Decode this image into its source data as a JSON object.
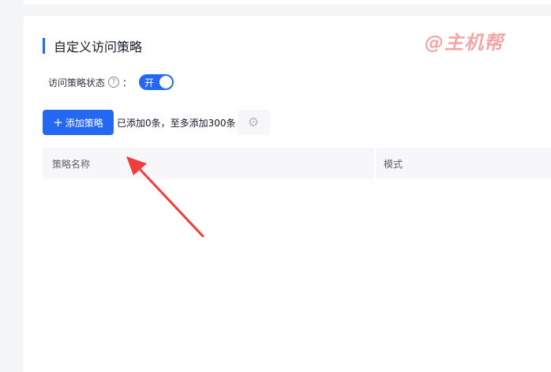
{
  "section": {
    "title": "自定义访问策略"
  },
  "watermark": {
    "text": "@主机帮"
  },
  "status": {
    "label": "访问策略状态",
    "help_icon": "help-circle-icon",
    "help_glyph": "?",
    "colon": "：",
    "toggle_text": "开",
    "toggle_on": true
  },
  "toolbar": {
    "add_label": "添加策略",
    "plus_glyph": "+",
    "count_text": "已添加0条，至多添加300条",
    "gear_icon": "gear-icon",
    "gear_glyph": "⚙"
  },
  "table": {
    "columns": [
      "策略名称",
      "模式"
    ]
  },
  "colors": {
    "accent": "#2468f2",
    "annotation_arrow": "#f23d3d",
    "watermark": "#f3a6a6"
  }
}
